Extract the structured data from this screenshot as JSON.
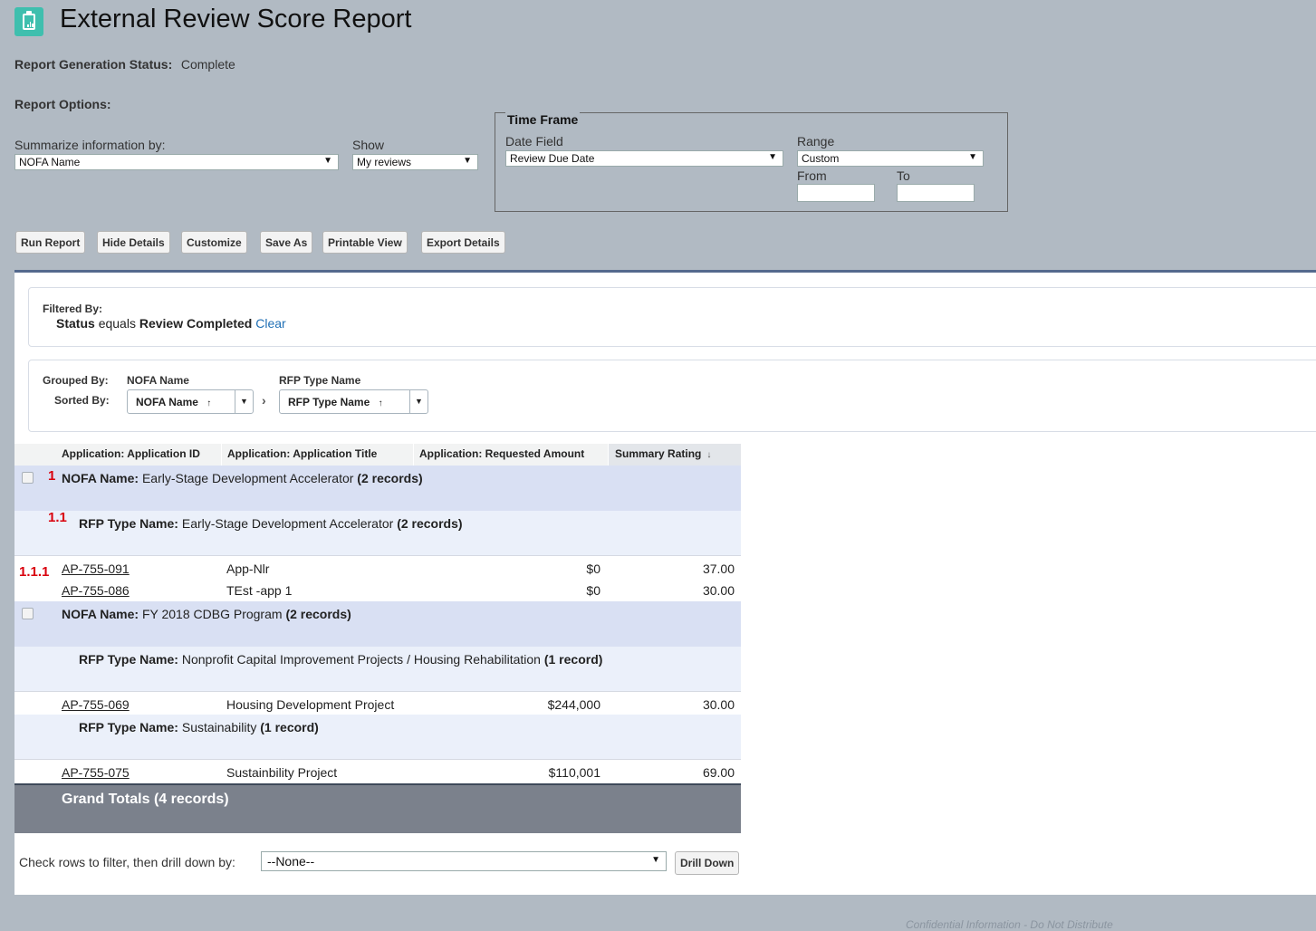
{
  "header": {
    "title": "External Review Score Report",
    "icon": "clipboard-chart-icon",
    "icon_color": "#3fbfae"
  },
  "status": {
    "label": "Report Generation Status:",
    "value": "Complete"
  },
  "options": {
    "label": "Report Options:",
    "summarize_label": "Summarize information by:",
    "summarize_value": "NOFA Name",
    "show_label": "Show",
    "show_value": "My reviews"
  },
  "time_frame": {
    "legend": "Time Frame",
    "date_field_label": "Date Field",
    "date_field_value": "Review Due Date",
    "range_label": "Range",
    "range_value": "Custom",
    "from_label": "From",
    "to_label": "To",
    "from_value": "",
    "to_value": ""
  },
  "buttons": {
    "run_report": "Run Report",
    "hide_details": "Hide Details",
    "customize": "Customize",
    "save_as": "Save As",
    "printable_view": "Printable View",
    "export_details": "Export Details"
  },
  "filter": {
    "label": "Filtered By:",
    "field": "Status",
    "operator": "equals",
    "value": "Review Completed",
    "clear": "Clear"
  },
  "grouping": {
    "grouped_by_label": "Grouped By:",
    "sorted_by_label": "Sorted By:",
    "group1": "NOFA Name",
    "group2": "RFP Type Name",
    "sort1": "NOFA Name",
    "sort2": "RFP Type Name",
    "sort_arrow": "↑",
    "dropdown_arrow": "▼",
    "chevron": "›"
  },
  "table": {
    "columns": [
      "Application: Application ID",
      "Application: Application Title",
      "Application: Requested Amount",
      "Summary Rating"
    ],
    "sort_indicator": "↓",
    "groups": [
      {
        "level1_label": "NOFA Name:",
        "level1_value": "Early-Stage Development Accelerator",
        "level1_count": "(2 records)",
        "subgroups": [
          {
            "label": "RFP Type Name:",
            "value": "Early-Stage Development Accelerator",
            "count": "(2 records)",
            "rows": [
              {
                "id": "AP-755-091",
                "title": "App-Nlr",
                "amount": "$0",
                "rating": "37.00"
              },
              {
                "id": "AP-755-086",
                "title": "TEst -app 1",
                "amount": "$0",
                "rating": "30.00"
              }
            ]
          }
        ]
      },
      {
        "level1_label": "NOFA Name:",
        "level1_value": "FY 2018 CDBG Program",
        "level1_count": "(2 records)",
        "subgroups": [
          {
            "label": "RFP Type Name:",
            "value": "Nonprofit Capital Improvement Projects / Housing Rehabilitation",
            "count": "(1 record)",
            "rows": [
              {
                "id": "AP-755-069",
                "title": "Housing Development Project",
                "amount": "$244,000",
                "rating": "30.00"
              }
            ]
          },
          {
            "label": "RFP Type Name:",
            "value": "Sustainability",
            "count": "(1 record)",
            "rows": [
              {
                "id": "AP-755-075",
                "title": "Sustainbility Project",
                "amount": "$110,001",
                "rating": "69.00"
              }
            ]
          }
        ]
      }
    ],
    "grand_total": "Grand Totals (4 records)"
  },
  "annotations": {
    "a1": "1",
    "a2": "1.1",
    "a3": "1.1.1",
    "color": "#d9000d"
  },
  "drilldown": {
    "label": "Check rows to filter, then drill down by:",
    "value": "--None--",
    "button": "Drill Down"
  },
  "footer": "Confidential Information - Do Not Distribute"
}
